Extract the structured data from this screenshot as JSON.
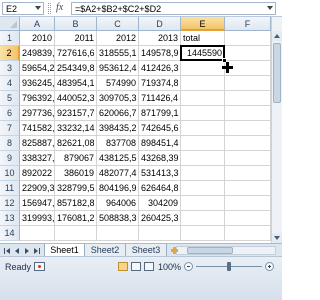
{
  "formula_bar": {
    "name_box": "E2",
    "fx_label": "fx",
    "formula": "=$A2+$B2+$C2+$D2"
  },
  "columns": [
    "A",
    "B",
    "C",
    "D",
    "E",
    "F"
  ],
  "active_cell": {
    "column": "E",
    "row": "2"
  },
  "rows": [
    {
      "num": "1",
      "cells": [
        "2010",
        "2011",
        "2012",
        "2013",
        "total",
        ""
      ]
    },
    {
      "num": "2",
      "cells": [
        "249839,6",
        "727616,6",
        "318555,1",
        "149578,9",
        "1445590",
        ""
      ]
    },
    {
      "num": "3",
      "cells": [
        "59654,21",
        "254349,8",
        "953612,4",
        "412426,3",
        "",
        ""
      ]
    },
    {
      "num": "4",
      "cells": [
        "936245,9",
        "483954,1",
        "574990",
        "719374,8",
        "",
        ""
      ]
    },
    {
      "num": "5",
      "cells": [
        "796392,2",
        "440052,3",
        "309705,3",
        "711426,4",
        "",
        ""
      ]
    },
    {
      "num": "6",
      "cells": [
        "297736,2",
        "923157,7",
        "620066,7",
        "871799,1",
        "",
        ""
      ]
    },
    {
      "num": "7",
      "cells": [
        "741582,6",
        "33232,14",
        "398435,2",
        "742645,6",
        "",
        ""
      ]
    },
    {
      "num": "8",
      "cells": [
        "825887,9",
        "82621,08",
        "837708",
        "898451,4",
        "",
        ""
      ]
    },
    {
      "num": "9",
      "cells": [
        "338327,7",
        "879067",
        "438125,5",
        "43268,39",
        "",
        ""
      ]
    },
    {
      "num": "10",
      "cells": [
        "892022",
        "386019",
        "482077,4",
        "531413,3",
        "",
        ""
      ]
    },
    {
      "num": "11",
      "cells": [
        "22909,31",
        "328799,5",
        "804196,9",
        "626464,8",
        "",
        ""
      ]
    },
    {
      "num": "12",
      "cells": [
        "156947,8",
        "857182,8",
        "964006",
        "304209",
        "",
        ""
      ]
    },
    {
      "num": "13",
      "cells": [
        "319993,2",
        "176081,2",
        "508838,3",
        "260425,3",
        "",
        ""
      ]
    },
    {
      "num": "14",
      "cells": [
        "",
        "",
        "",
        "",
        "",
        ""
      ]
    }
  ],
  "sheet_tabs": [
    "Sheet1",
    "Sheet2",
    "Sheet3"
  ],
  "active_sheet": "Sheet1",
  "status": {
    "mode": "Ready",
    "zoom_label": "100%",
    "zoom_percent": 100
  },
  "colors": {
    "header_bg": "#dfe7f1",
    "active_header": "#f2c468",
    "grid_line": "#d4d4d4"
  },
  "icons": [
    "chevron-down-icon",
    "fx-icon",
    "fill-handle-icon",
    "plus-cursor-icon",
    "insert-sheet-icon",
    "macro-record-icon",
    "normal-view-icon",
    "page-layout-icon",
    "page-break-icon",
    "zoom-out-icon",
    "zoom-in-icon"
  ]
}
